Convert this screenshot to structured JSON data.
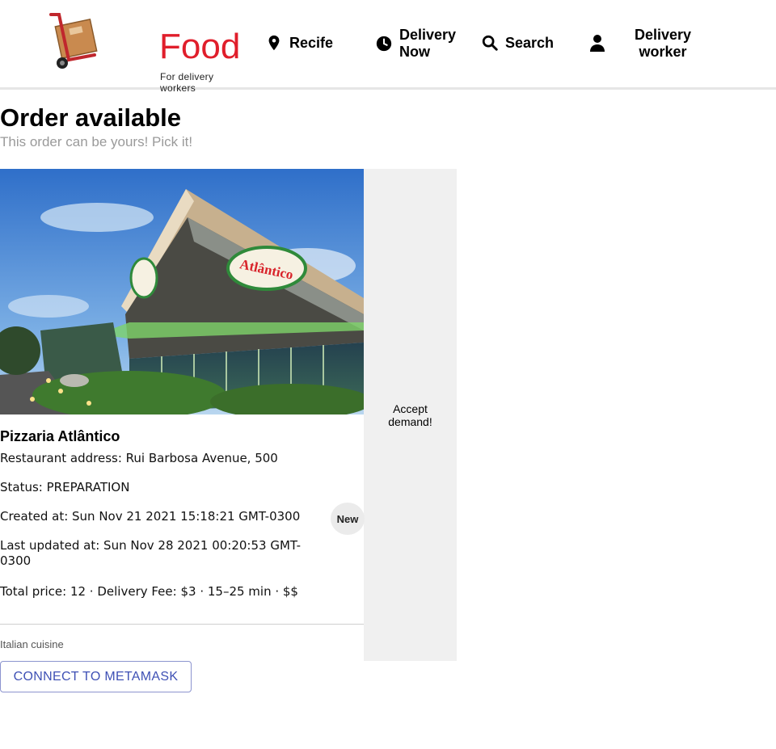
{
  "brand": {
    "name": "Food",
    "tagline": "For delivery workers",
    "color": "#e01e2b"
  },
  "nav": {
    "location": "Recife",
    "delivery_now_line1": "Delivery",
    "delivery_now_line2": "Now",
    "search": "Search",
    "worker_line1": "Delivery",
    "worker_line2": "worker"
  },
  "page": {
    "title": "Order available",
    "subtitle": "This order can be yours! Pick it!"
  },
  "order": {
    "restaurant_name": "Pizzaria Atlântico",
    "address": "Restaurant address: Rui Barbosa Avenue, 500",
    "status": "Status: PREPARATION",
    "created_at": "Created at: Sun Nov 21 2021 15:18:21 GMT-0300",
    "updated_at_line1": "Last updated at: Sun Nov 28 2021 00:20:53 GMT-",
    "updated_at_line2": "0300",
    "pricing": "Total price: 12 · Delivery Fee: $3 · 15–25 min · $$",
    "badge": "New",
    "cuisine": "Italian cuisine",
    "accept_label": "Accept demand!",
    "sign_text": "Atlântico"
  },
  "actions": {
    "connect": "CONNECT TO METAMASK"
  },
  "colors": {
    "accent_button": "#3f51b5",
    "panel_bg": "#f0f0f0"
  }
}
